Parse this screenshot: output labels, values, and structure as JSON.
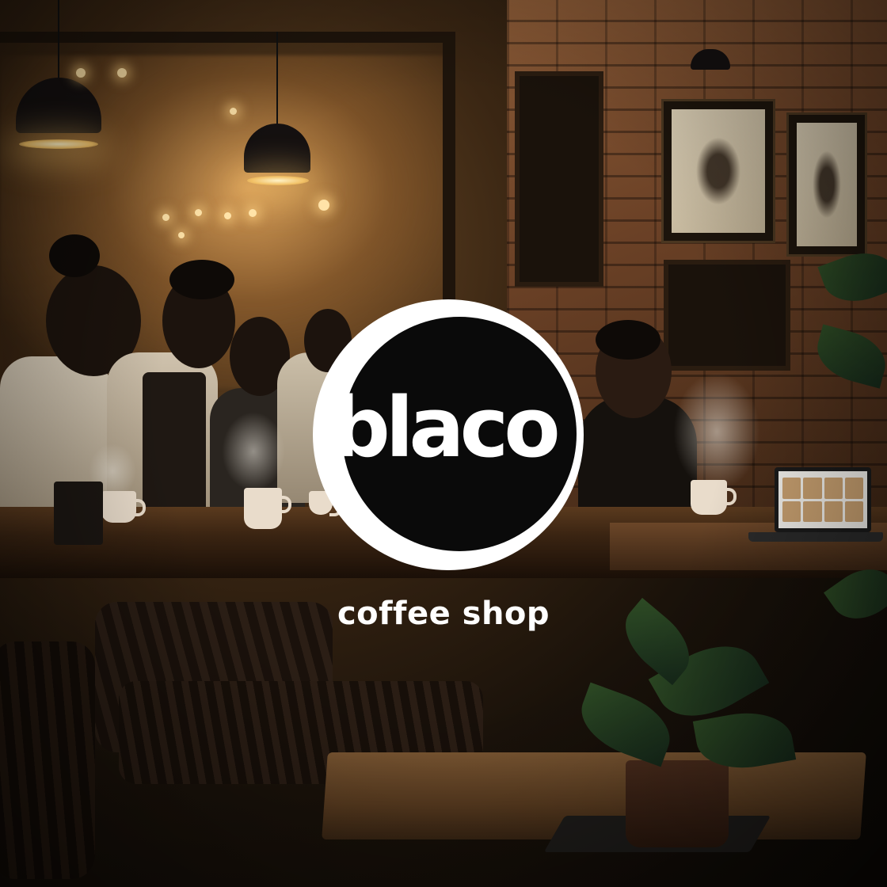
{
  "brand": {
    "name": "blaco",
    "tagline": "coffee shop"
  },
  "colors": {
    "logo_ring": "#ffffff",
    "logo_disc": "#0a0a0a",
    "text": "#ffffff",
    "ambient": "#6b4a26"
  },
  "scene": {
    "icons": [
      "pendant-lamp-icon",
      "coffee-cup-icon",
      "laptop-icon",
      "plant-icon",
      "picture-frame-icon"
    ]
  }
}
